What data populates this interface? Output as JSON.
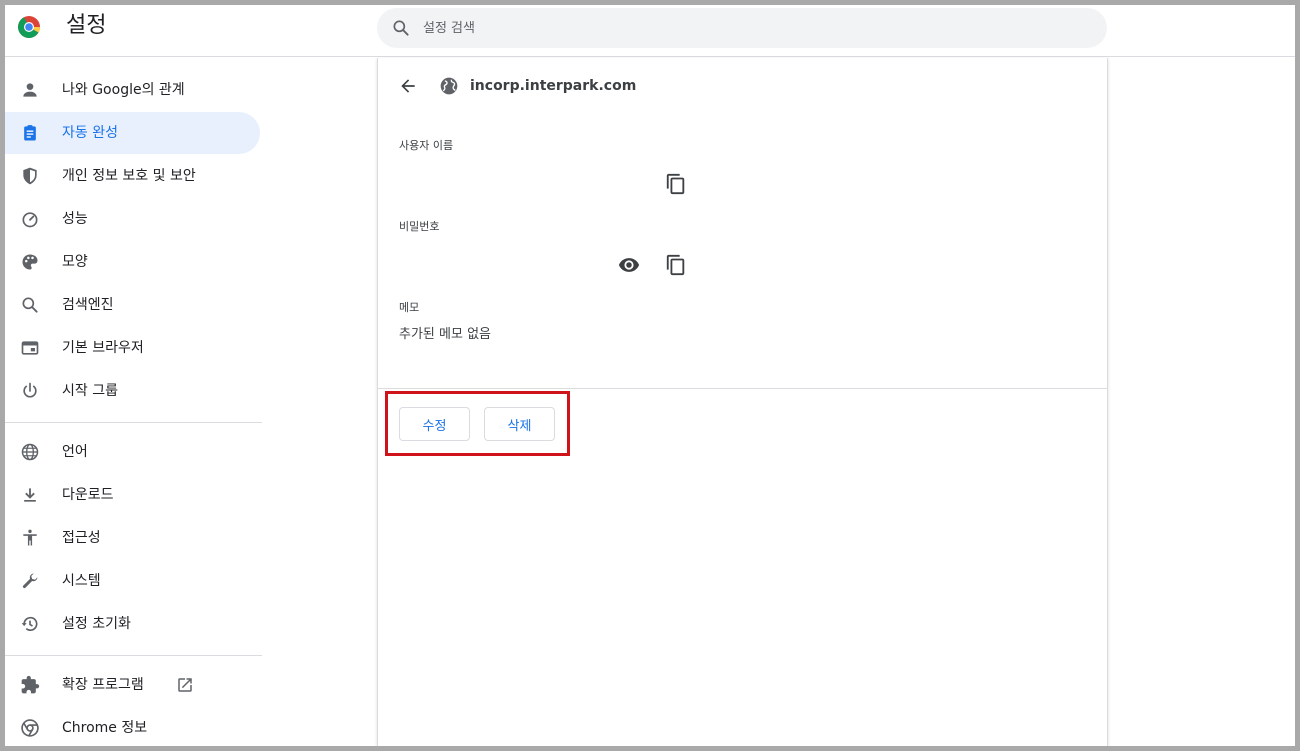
{
  "header": {
    "title": "설정",
    "search_placeholder": "설정 검색"
  },
  "sidebar": {
    "items": [
      {
        "label": "나와 Google의 관계",
        "icon": "person-icon"
      },
      {
        "label": "자동 완성",
        "icon": "clipboard-icon",
        "active": true
      },
      {
        "label": "개인 정보 보호 및 보안",
        "icon": "shield-icon"
      },
      {
        "label": "성능",
        "icon": "speedometer-icon"
      },
      {
        "label": "모양",
        "icon": "palette-icon"
      },
      {
        "label": "검색엔진",
        "icon": "search-icon"
      },
      {
        "label": "기본 브라우저",
        "icon": "browser-icon"
      },
      {
        "label": "시작 그룹",
        "icon": "power-icon"
      },
      {
        "label": "언어",
        "icon": "globe-icon"
      },
      {
        "label": "다운로드",
        "icon": "download-icon"
      },
      {
        "label": "접근성",
        "icon": "accessibility-icon"
      },
      {
        "label": "시스템",
        "icon": "wrench-icon"
      },
      {
        "label": "설정 초기화",
        "icon": "history-icon"
      },
      {
        "label": "확장 프로그램",
        "icon": "puzzle-icon"
      },
      {
        "label": "Chrome 정보",
        "icon": "chrome-icon"
      }
    ]
  },
  "detail": {
    "site": "incorp.interpark.com",
    "username_label": "사용자 이름",
    "password_label": "비밀번호",
    "memo_label": "메모",
    "memo_value": "추가된 메모 없음",
    "edit_label": "수정",
    "delete_label": "삭제"
  },
  "colors": {
    "accent": "#1a73e8",
    "active_bg": "#e8f0fe",
    "highlight": "#d0121b"
  }
}
